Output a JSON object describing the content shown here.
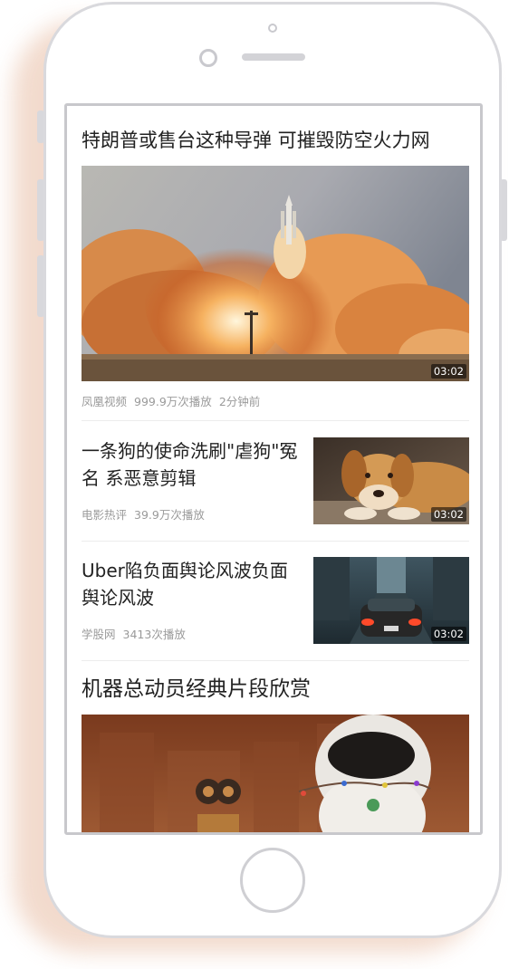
{
  "feed": {
    "items": [
      {
        "title": "特朗普或售台这种导弹 可摧毁防空火力网",
        "source": "凤凰视频",
        "plays": "999.9万次播放",
        "time": "2分钟前",
        "duration": "03:02",
        "thumb_icon": "rocket-launch-photo"
      },
      {
        "title": "一条狗的使命洗刷\"虐狗\"冤名 系恶意剪辑",
        "source": "电影热评",
        "plays": "39.9万次播放",
        "duration": "03:02",
        "thumb_icon": "dog-photo"
      },
      {
        "title": "Uber陷负面舆论风波负面舆论风波",
        "source": "学股网",
        "plays": "3413次播放",
        "duration": "03:02",
        "thumb_icon": "car-street-photo"
      },
      {
        "title": "机器总动员经典片段欣赏",
        "thumb_icon": "robots-photo"
      }
    ]
  },
  "colors": {
    "title": "#222222",
    "meta": "#9a9a9a",
    "divider": "#ececec",
    "phone_frame": "#d9d9dd",
    "phone_shadow": "#f1d7c8"
  }
}
